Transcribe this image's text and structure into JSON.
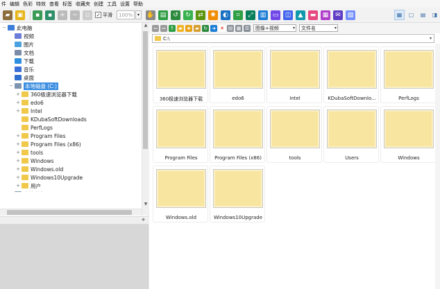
{
  "menu": [
    "件",
    "编辑",
    "色彩",
    "特效",
    "查看",
    "标签",
    "收藏夹",
    "创建",
    "工具",
    "设置",
    "帮助"
  ],
  "toolbar": {
    "fit_checkbox_label": "平滑",
    "zoom_value": "100%",
    "icons": [
      "folder-open-icon",
      "save-icon",
      "save-as-icon",
      "print-icon",
      "zoom-in-icon",
      "zoom-out-icon",
      "fit-icon",
      "zoom-dropdown"
    ]
  },
  "toolbar_colors": {
    "green": "#2f9e44",
    "orange": "#f08c00",
    "purple": "#7048e8",
    "blue": "#1c7ed6",
    "red": "#e03131"
  },
  "filter": {
    "type_value": "图像+视频",
    "sort_value": "文件名"
  },
  "address": {
    "path": "C:\\"
  },
  "tree": [
    {
      "label": "此电脑",
      "level": 0,
      "icon": "computer",
      "exp": "−"
    },
    {
      "label": "视频",
      "level": 1,
      "icon": "video",
      "exp": ""
    },
    {
      "label": "图片",
      "level": 1,
      "icon": "image",
      "exp": ""
    },
    {
      "label": "文档",
      "level": 1,
      "icon": "doc",
      "exp": ""
    },
    {
      "label": "下载",
      "level": 1,
      "icon": "download",
      "exp": ""
    },
    {
      "label": "音乐",
      "level": 1,
      "icon": "music",
      "exp": ""
    },
    {
      "label": "桌面",
      "level": 1,
      "icon": "desktop",
      "exp": ""
    },
    {
      "label": "本地磁盘 (C:)",
      "level": 1,
      "icon": "drive",
      "exp": "−",
      "selected": true
    },
    {
      "label": "360极速浏览器下载",
      "level": 2,
      "icon": "folder",
      "exp": "+"
    },
    {
      "label": "edo6",
      "level": 2,
      "icon": "folder",
      "exp": "+"
    },
    {
      "label": "Intel",
      "level": 2,
      "icon": "folder",
      "exp": "+"
    },
    {
      "label": "KDubaSoftDownloads",
      "level": 2,
      "icon": "folder",
      "exp": ""
    },
    {
      "label": "PerfLogs",
      "level": 2,
      "icon": "folder",
      "exp": ""
    },
    {
      "label": "Program Files",
      "level": 2,
      "icon": "folder",
      "exp": "+"
    },
    {
      "label": "Program Files (x86)",
      "level": 2,
      "icon": "folder",
      "exp": "+"
    },
    {
      "label": "tools",
      "level": 2,
      "icon": "folder",
      "exp": "+"
    },
    {
      "label": "Windows",
      "level": 2,
      "icon": "folder",
      "exp": "+"
    },
    {
      "label": "Windows.old",
      "level": 2,
      "icon": "folder",
      "exp": "+"
    },
    {
      "label": "Windows10Upgrade",
      "level": 2,
      "icon": "folder",
      "exp": "+"
    },
    {
      "label": "用户",
      "level": 2,
      "icon": "folder",
      "exp": "+"
    },
    {
      "label": "本地磁盘 (D:)",
      "level": 1,
      "icon": "drive",
      "exp": "+"
    }
  ],
  "tiles": [
    "360极速浏览器下载",
    "edo6",
    "Intel",
    "KDubaSoftDownlo...",
    "PerfLogs",
    "Program Files",
    "Program Files (x86)",
    "tools",
    "Users",
    "Windows",
    "Windows.old",
    "Windows10Upgrade"
  ]
}
